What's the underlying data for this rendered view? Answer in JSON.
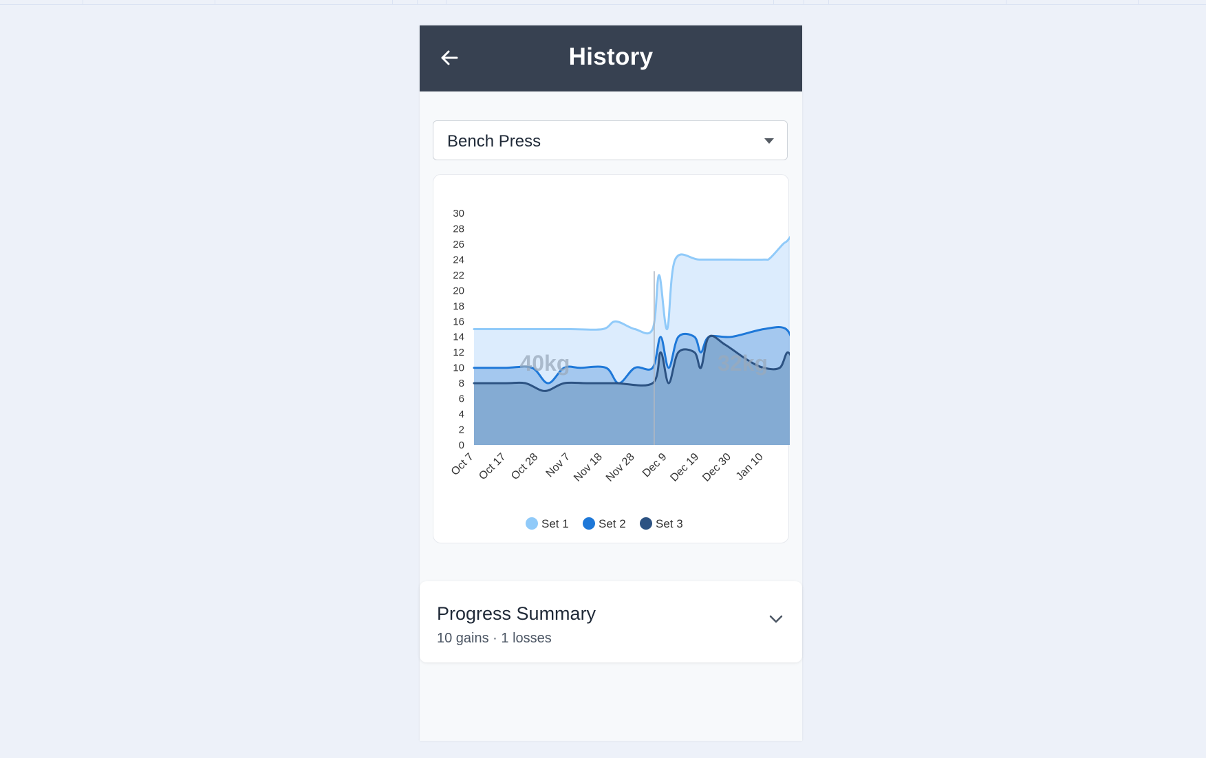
{
  "header": {
    "title": "History",
    "back_icon": "arrow-left-icon"
  },
  "exercise_select": {
    "selected": "Bench Press",
    "caret_icon": "caret-down-icon"
  },
  "chart_data": {
    "type": "area",
    "categories": [
      "Oct 7",
      "Oct 17",
      "Oct 28",
      "Nov 7",
      "Nov 18",
      "Nov 28",
      "Dec 9",
      "Dec 19",
      "Dec 30",
      "Jan 10"
    ],
    "x_ticks": [
      "Oct 7",
      "Oct 17",
      "Oct 28",
      "Nov 7",
      "Nov 18",
      "Nov 28",
      "Dec 9",
      "Dec 19",
      "Dec 30",
      "Jan 10"
    ],
    "ylim": [
      0,
      30
    ],
    "y_ticks": [
      0,
      2,
      4,
      6,
      8,
      10,
      12,
      14,
      16,
      18,
      20,
      22,
      24,
      26,
      28,
      30
    ],
    "grid": false,
    "legend_position": "bottom",
    "annotations": [
      {
        "text": "40kg",
        "x": 2.2,
        "y": 10.5
      },
      {
        "text": "32kg",
        "x": 8.35,
        "y": 10.5
      }
    ],
    "marker_line_x": 5.6,
    "series": [
      {
        "name": "Set 1",
        "color": "#90caf9",
        "fill": "#bfdcfb",
        "points": [
          [
            0,
            15
          ],
          [
            1,
            15
          ],
          [
            2,
            15
          ],
          [
            3,
            15
          ],
          [
            4,
            15
          ],
          [
            4.4,
            16
          ],
          [
            5,
            15
          ],
          [
            5.55,
            15
          ],
          [
            5.75,
            22
          ],
          [
            6.0,
            15
          ],
          [
            6.25,
            24
          ],
          [
            7,
            24
          ],
          [
            8,
            24
          ],
          [
            9,
            24
          ],
          [
            9.2,
            24.2
          ],
          [
            9.6,
            26
          ],
          [
            9.75,
            26.5
          ],
          [
            10,
            28
          ]
        ]
      },
      {
        "name": "Set 2",
        "color": "#1e78d8",
        "fill": "#7fb0e6",
        "points": [
          [
            0,
            10
          ],
          [
            1,
            10
          ],
          [
            1.8,
            10
          ],
          [
            2.3,
            8
          ],
          [
            2.8,
            10
          ],
          [
            3.3,
            10
          ],
          [
            4.1,
            10
          ],
          [
            4.5,
            8
          ],
          [
            5.0,
            10
          ],
          [
            5.55,
            10
          ],
          [
            5.8,
            14
          ],
          [
            6.05,
            10
          ],
          [
            6.35,
            14
          ],
          [
            6.85,
            14
          ],
          [
            7.05,
            12
          ],
          [
            7.3,
            14
          ],
          [
            8.0,
            14
          ],
          [
            9,
            15
          ],
          [
            9.7,
            15
          ],
          [
            10,
            12
          ]
        ]
      },
      {
        "name": "Set 3",
        "color": "#2c5282",
        "fill": "#6f97c0",
        "points": [
          [
            0,
            8
          ],
          [
            1,
            8
          ],
          [
            1.6,
            8
          ],
          [
            2.2,
            7
          ],
          [
            2.8,
            8
          ],
          [
            3.5,
            8
          ],
          [
            4.4,
            8
          ],
          [
            5.55,
            8
          ],
          [
            5.8,
            12
          ],
          [
            6.05,
            8
          ],
          [
            6.35,
            12
          ],
          [
            6.85,
            12
          ],
          [
            7.05,
            10
          ],
          [
            7.3,
            14
          ],
          [
            7.8,
            13
          ],
          [
            8.5,
            11
          ],
          [
            9.0,
            10
          ],
          [
            9.5,
            10
          ],
          [
            9.75,
            12
          ],
          [
            10,
            10
          ]
        ]
      }
    ]
  },
  "summary": {
    "title": "Progress Summary",
    "subtitle": "10 gains · 1 losses",
    "chevron_icon": "chevron-down-icon"
  }
}
